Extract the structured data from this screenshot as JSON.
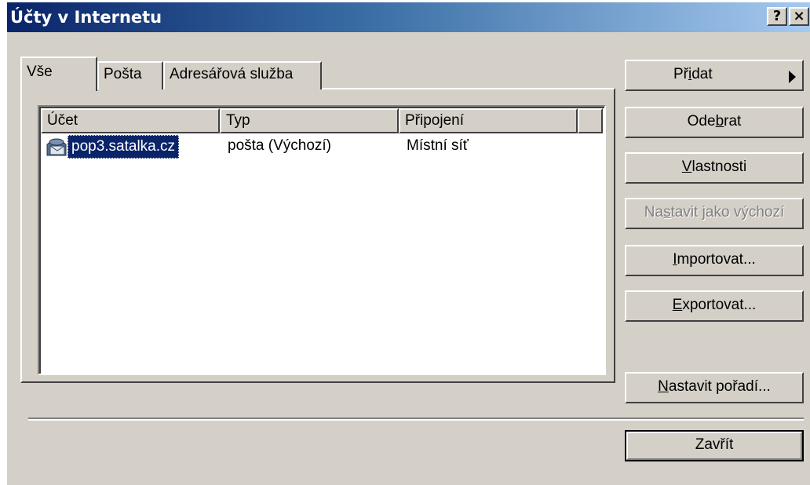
{
  "window": {
    "title": "Účty v Internetu",
    "help_button": "?",
    "close_button": "×"
  },
  "tabs": [
    {
      "label": "Vše",
      "active": true
    },
    {
      "label": "Pošta",
      "active": false
    },
    {
      "label": "Adresářová služba",
      "active": false
    }
  ],
  "list": {
    "columns": [
      "Účet",
      "Typ",
      "Připojení"
    ],
    "rows": [
      {
        "account": "pop3.satalka.cz",
        "type": "pošta (Výchozí)",
        "connection": "Místní síť",
        "icon": "mail-account-icon",
        "selected": true
      }
    ]
  },
  "buttons": {
    "add": {
      "pre": "Př",
      "acc": "i",
      "post": "dat"
    },
    "remove": {
      "pre": "Ode",
      "acc": "b",
      "post": "rat"
    },
    "properties": {
      "pre": "",
      "acc": "V",
      "post": "lastnosti"
    },
    "set_default": {
      "pre": "Na",
      "acc": "s",
      "post": "tavit jako výchozí",
      "enabled": false
    },
    "import": {
      "pre": "",
      "acc": "I",
      "post": "mportovat..."
    },
    "export": {
      "pre": "",
      "acc": "E",
      "post": "xportovat..."
    },
    "set_order": {
      "pre": "",
      "acc": "N",
      "post": "astavit pořadí..."
    },
    "close": {
      "label": "Zavřít"
    }
  }
}
